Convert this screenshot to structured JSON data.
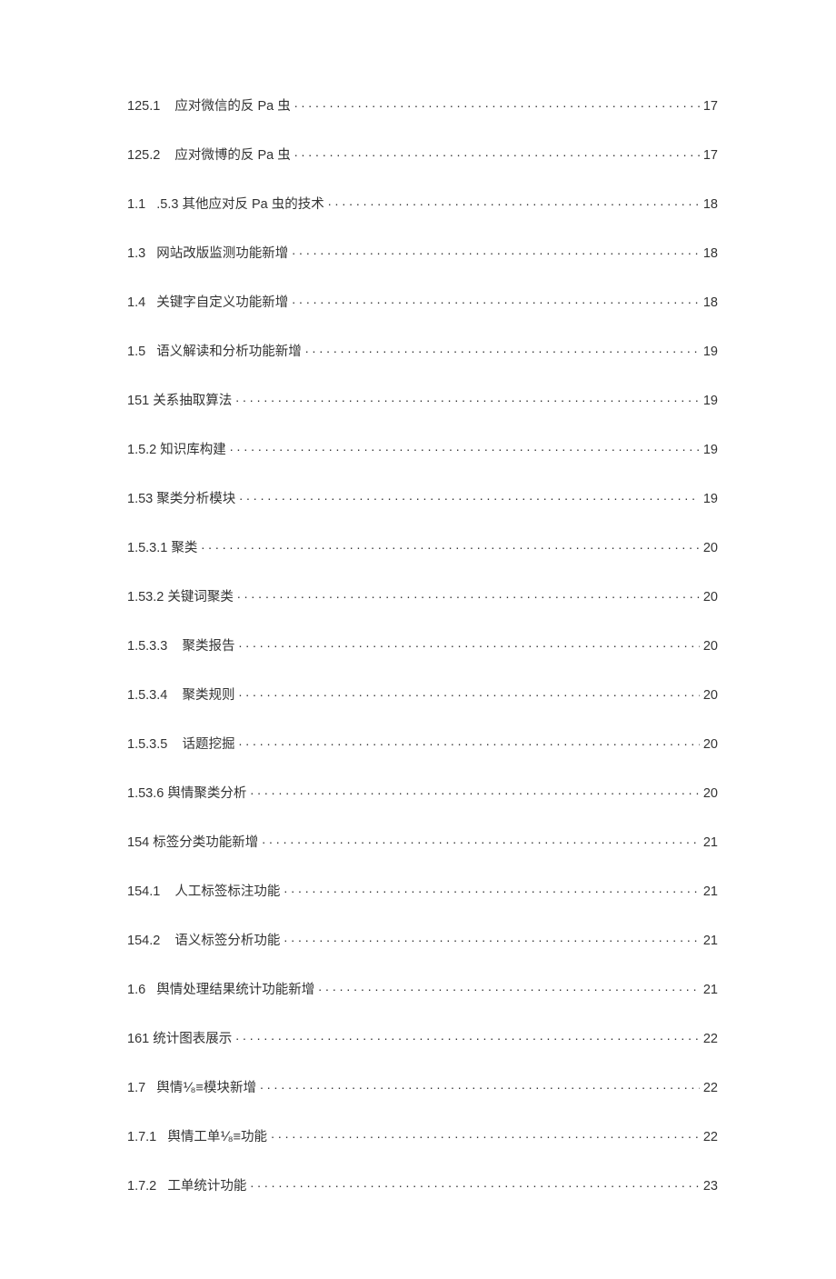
{
  "toc": [
    {
      "num": "125.1",
      "gap": "    ",
      "label": "应对微信的反 Pa 虫",
      "page": "17"
    },
    {
      "num": "125.2",
      "gap": "    ",
      "label": "应对微博的反 Pa 虫",
      "page": "17"
    },
    {
      "num": "1.1",
      "gap": "   ",
      "label": ".5.3 其他应对反 Pa 虫的技术",
      "page": "18"
    },
    {
      "num": "1.3",
      "gap": "   ",
      "label": "网站改版监测功能新增",
      "page": "18"
    },
    {
      "num": "1.4",
      "gap": "   ",
      "label": "关键字自定义功能新增",
      "page": "18"
    },
    {
      "num": "1.5",
      "gap": "   ",
      "label": "语义解读和分析功能新增",
      "page": "19"
    },
    {
      "num": "151 关系抽取算法",
      "gap": "",
      "label": "",
      "page": "19"
    },
    {
      "num": "1.5.2 知识库构建",
      "gap": "",
      "label": "",
      "page": "19"
    },
    {
      "num": "1.53 聚类分析模块",
      "gap": "",
      "label": "",
      "page": "19"
    },
    {
      "num": "1.5.3.1 聚类",
      "gap": "",
      "label": "",
      "page": "20"
    },
    {
      "num": "1.53.2 关键词聚类",
      "gap": "",
      "label": "",
      "page": "20"
    },
    {
      "num": "1.5.3.3",
      "gap": "    ",
      "label": "聚类报告",
      "page": "20"
    },
    {
      "num": "1.5.3.4",
      "gap": "    ",
      "label": "聚类规则",
      "page": "20"
    },
    {
      "num": "1.5.3.5",
      "gap": "    ",
      "label": "话题挖掘",
      "page": "20"
    },
    {
      "num": "1.53.6 舆情聚类分析",
      "gap": "",
      "label": "",
      "page": "20"
    },
    {
      "num": "154 标签分类功能新增",
      "gap": "",
      "label": "",
      "page": "21"
    },
    {
      "num": "154.1",
      "gap": "    ",
      "label": "人工标签标注功能",
      "page": "21"
    },
    {
      "num": "154.2",
      "gap": "    ",
      "label": "语义标签分析功能",
      "page": "21"
    },
    {
      "num": "1.6",
      "gap": "   ",
      "label": "舆情处理结果统计功能新增",
      "page": "21"
    },
    {
      "num": "161 统计图表展示",
      "gap": "",
      "label": "",
      "page": "22"
    },
    {
      "num": "1.7",
      "gap": "   ",
      "label": "舆情⅟₈≡模块新增",
      "page": "22"
    },
    {
      "num": "1.7.1",
      "gap": "   ",
      "label": "舆情工单⅟₈≡功能",
      "page": "22"
    },
    {
      "num": "1.7.2",
      "gap": "   ",
      "label": "工单统计功能",
      "page": "23"
    }
  ]
}
